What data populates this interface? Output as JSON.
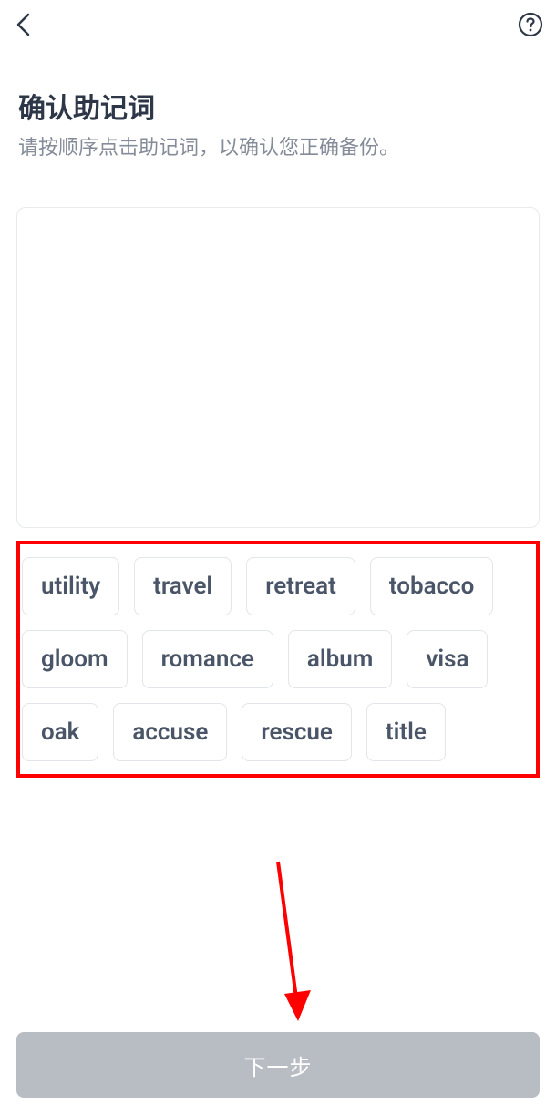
{
  "header": {
    "back_icon": "chevron-left",
    "help_icon": "question-circle"
  },
  "title": "确认助记词",
  "subtitle": "请按顺序点击助记词，以确认您正确备份。",
  "words": [
    "utility",
    "travel",
    "retreat",
    "tobacco",
    "gloom",
    "romance",
    "album",
    "visa",
    "oak",
    "accuse",
    "rescue",
    "title"
  ],
  "next_button_label": "下一步",
  "annotations": {
    "highlight_border_color": "#ff0000",
    "arrow_color": "#ff0000"
  }
}
